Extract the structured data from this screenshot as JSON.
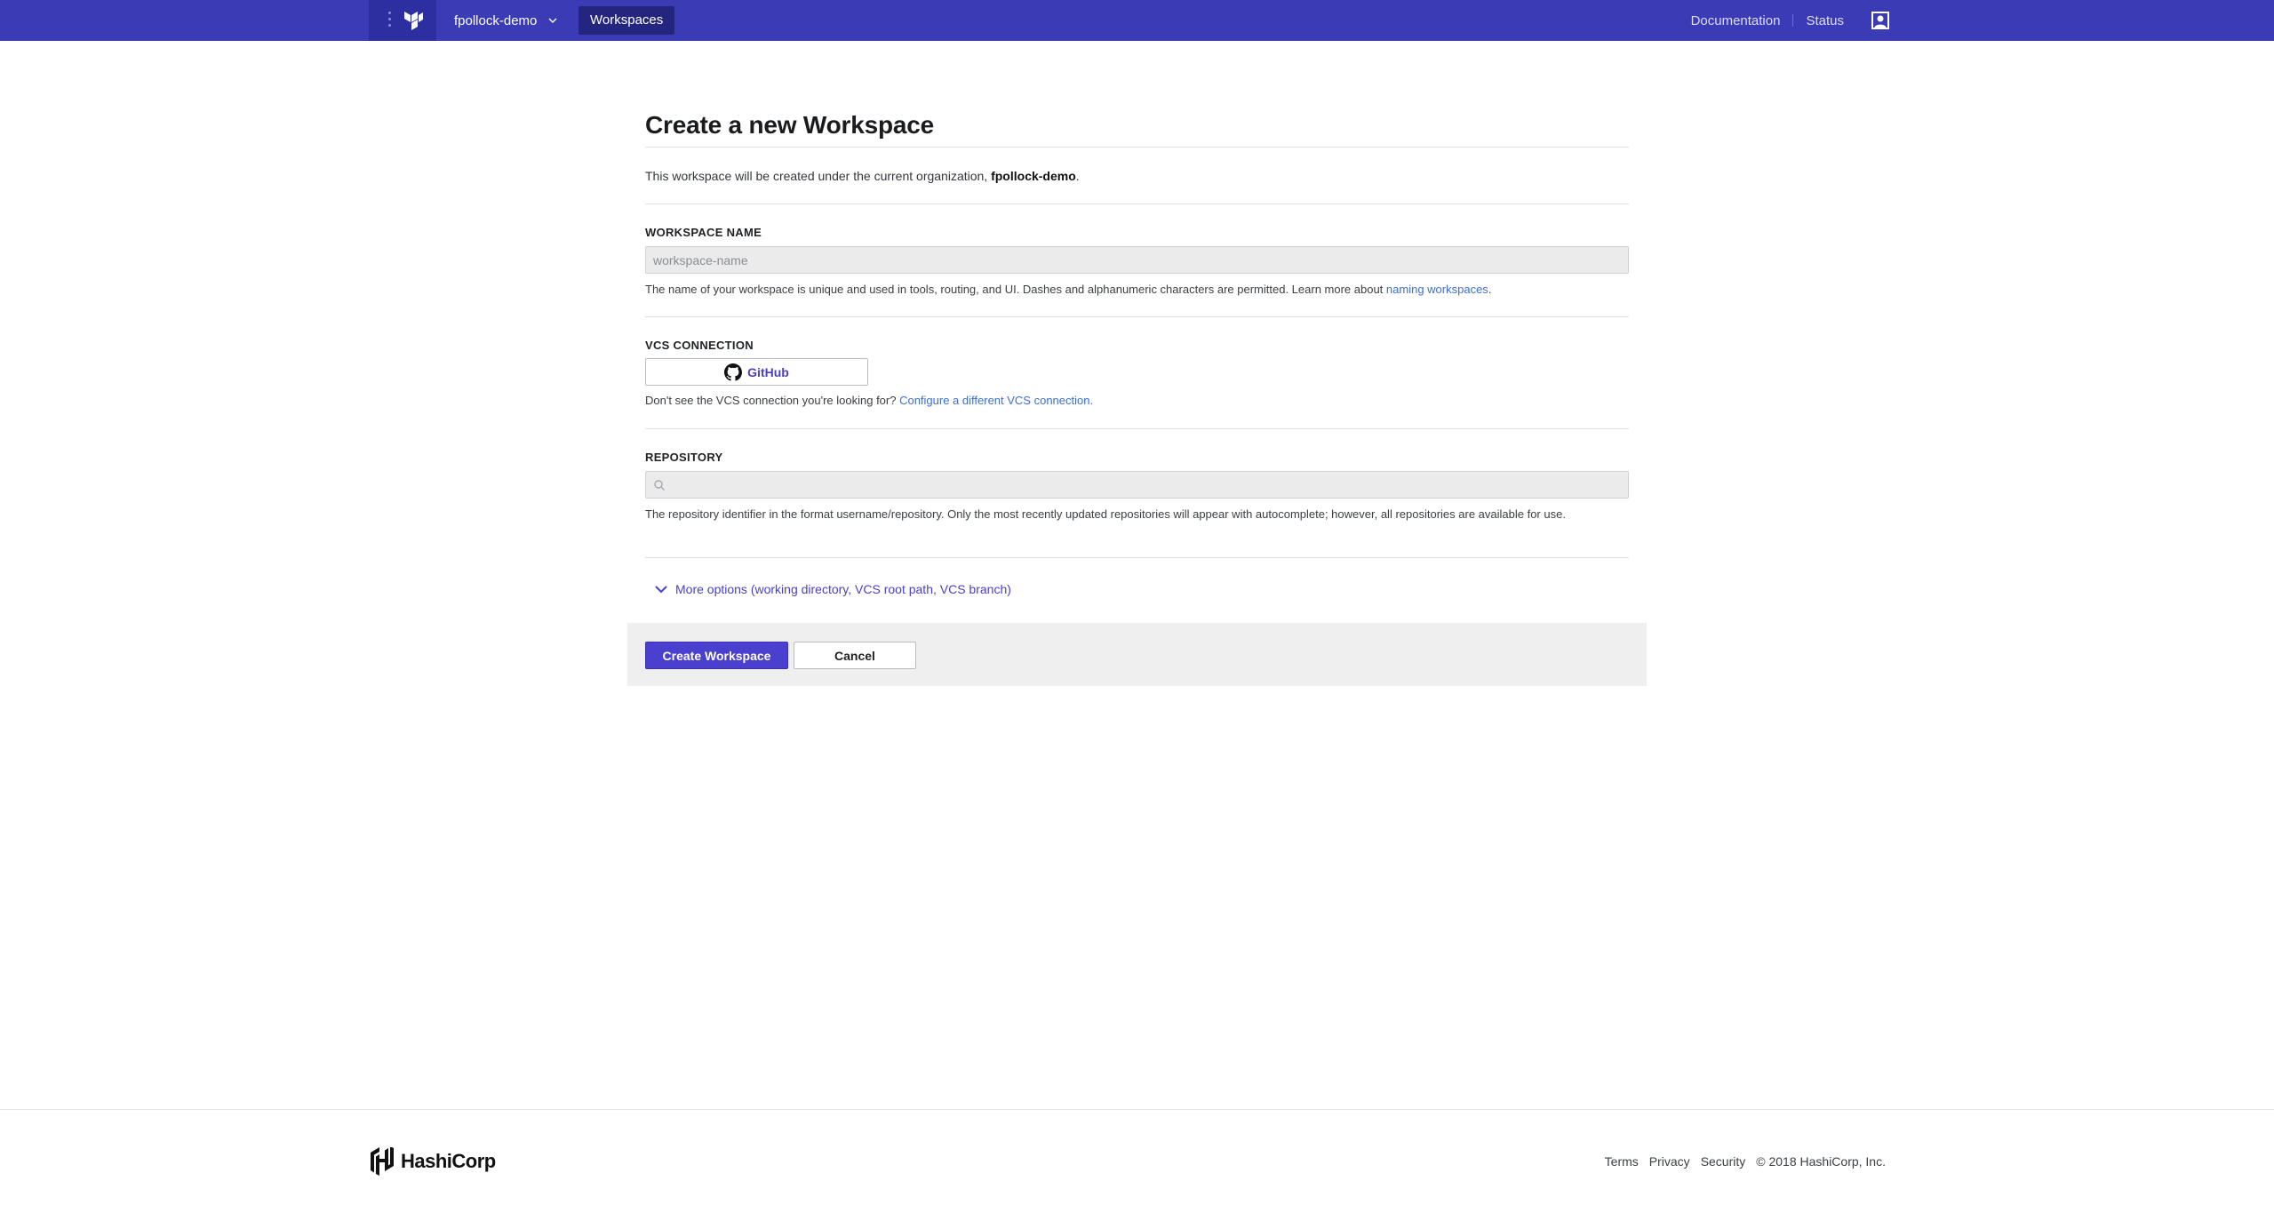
{
  "topnav": {
    "org_name": "fpollock-demo",
    "workspaces_tab": "Workspaces",
    "documentation": "Documentation",
    "status": "Status"
  },
  "page": {
    "title": "Create a new Workspace",
    "intro_prefix": "This workspace will be created under the current organization, ",
    "intro_org": "fpollock-demo",
    "intro_suffix": "."
  },
  "workspace_name": {
    "label": "WORKSPACE NAME",
    "placeholder": "workspace-name",
    "value": "",
    "help_text": "The name of your workspace is unique and used in tools, routing, and UI. Dashes and alphanumeric characters are permitted. Learn more about ",
    "help_link": "naming workspaces",
    "help_suffix": "."
  },
  "vcs": {
    "label": "VCS CONNECTION",
    "button_label": "GitHub",
    "help_text": "Don't see the VCS connection you're looking for? ",
    "help_link": "Configure a different VCS connection."
  },
  "repository": {
    "label": "REPOSITORY",
    "placeholder": "",
    "value": "",
    "help_text": "The repository identifier in the format username/repository. Only the most recently updated repositories will appear with autocomplete; however, all repositories are available for use."
  },
  "more_options": "More options (working directory, VCS root path, VCS branch)",
  "actions": {
    "create": "Create Workspace",
    "cancel": "Cancel"
  },
  "footer": {
    "brand": "HashiCorp",
    "links": [
      "Terms",
      "Privacy",
      "Security"
    ],
    "copyright": "© 2018 HashiCorp, Inc."
  },
  "colors": {
    "nav_bg": "#3a3bb5",
    "accent": "#4b3fcf",
    "link": "#3b6fd6"
  }
}
